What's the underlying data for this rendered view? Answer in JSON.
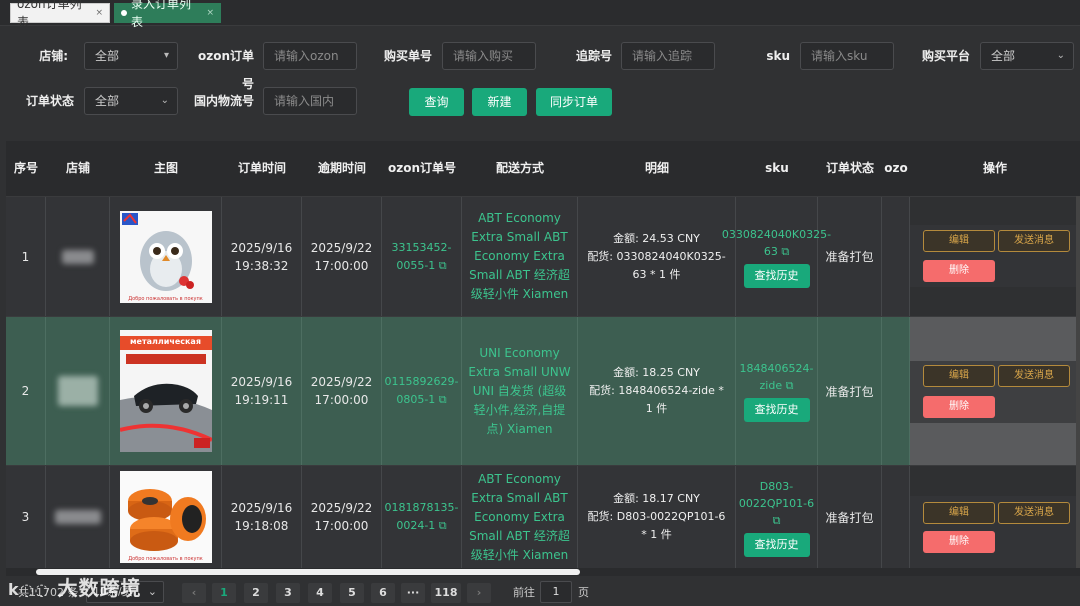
{
  "tabs": [
    {
      "label": "ozon订单列表",
      "close": "×"
    },
    {
      "label": "录入订单列表",
      "close": "×"
    }
  ],
  "filters": {
    "shop_label": "店铺:",
    "shop_value": "全部",
    "ozon_no_label": "ozon订单号",
    "ozon_no_placeholder": "请输入ozon",
    "purchase_no_label": "购买单号",
    "purchase_no_placeholder": "请输入购买",
    "tracking_label": "追踪号",
    "tracking_placeholder": "请输入追踪",
    "sku_label": "sku",
    "sku_placeholder": "请输入sku",
    "platform_label": "购买平台",
    "platform_value": "全部",
    "status_label": "订单状态",
    "status_value": "全部",
    "domestic_label": "国内物流号",
    "domestic_placeholder": "请输入国内",
    "query_btn": "查询",
    "new_btn": "新建",
    "sync_btn": "同步订单"
  },
  "table": {
    "headers": [
      "序号",
      "店铺",
      "主图",
      "订单时间",
      "逾期时间",
      "ozon订单号",
      "配送方式",
      "明细",
      "sku",
      "订单状态",
      "ozo",
      "操作"
    ],
    "rows": [
      {
        "index": "1",
        "order_time": "2025/9/16 19:38:32",
        "due_time": "2025/9/22 17:00:00",
        "ozon_no": "33153452-0055-1",
        "delivery": "ABT Economy Extra Small ABT Economy Extra Small ABT 经济超级轻小件 Xiamen",
        "amount": "金额: 24.53 CNY",
        "goods": "配货: 0330824040K0325-63 * 1 件",
        "sku": "0330824040K0325-63",
        "status": "准备打包",
        "thumb_caption": "Добро пожаловать в покупк"
      },
      {
        "index": "2",
        "order_time": "2025/9/16 19:19:11",
        "due_time": "2025/9/22 17:00:00",
        "ozon_no": "0115892629-0805-1",
        "delivery": "UNI Economy Extra Small UNW UNI 自发货 (超级轻小件,经济,自提点) Xiamen",
        "amount": "金额: 18.25 CNY",
        "goods": "配货: 1848406524-zide * 1 件",
        "sku": "1848406524-zide",
        "status": "准备打包",
        "thumb_caption": "металлическая"
      },
      {
        "index": "3",
        "order_time": "2025/9/16 19:18:08",
        "due_time": "2025/9/22 17:00:00",
        "ozon_no": "0181878135-0024-1",
        "delivery": "ABT Economy Extra Small ABT Economy Extra Small ABT 经济超级轻小件 Xiamen",
        "amount": "金额: 18.17 CNY",
        "goods": "配货: D803-0022QP101-6 * 1 件",
        "sku": "D803-0022QP101-6",
        "status": "准备打包",
        "thumb_caption": "Добро пожаловать в покупк"
      }
    ],
    "history_btn": "查找历史",
    "edit_btn": "编辑",
    "msg_btn": "发送消息",
    "delete_btn": "删除"
  },
  "pagination": {
    "total": "共11702 条",
    "page_size": "10条/页",
    "pages": [
      "1",
      "2",
      "3",
      "4",
      "5",
      "6",
      "···",
      "118"
    ],
    "goto_label": "前往",
    "goto_value": "1",
    "page_unit": "页",
    "prev": "‹",
    "next": "›"
  },
  "watermark": "大数跨境",
  "colors": {
    "accent": "#19a97b",
    "link": "#3cc48e",
    "danger": "#f56c6c",
    "warning": "#d9a64a",
    "selected_row": "#3d5e51"
  }
}
